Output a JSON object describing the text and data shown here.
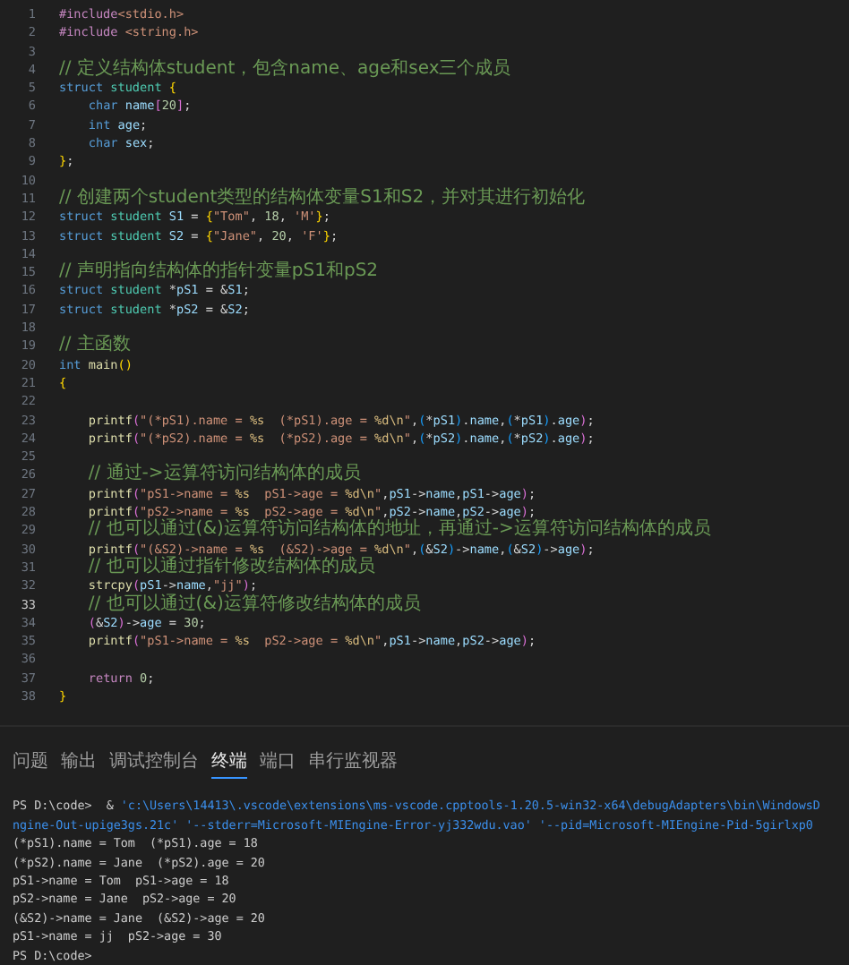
{
  "editor": {
    "lines": [
      {
        "number": "1",
        "active": false,
        "indented": false,
        "tokens": [
          {
            "kind": "pp",
            "text": "#include"
          },
          {
            "kind": "s",
            "text": "<stdio.h>"
          }
        ]
      },
      {
        "number": "2",
        "active": false,
        "indented": false,
        "tokens": [
          {
            "kind": "pp",
            "text": "#include "
          },
          {
            "kind": "s",
            "text": "<string.h>"
          }
        ]
      },
      {
        "number": "3",
        "active": false
      },
      {
        "number": "4",
        "active": false,
        "indented": false,
        "tokens": [
          {
            "kind": "c",
            "text": "// 定义结构体student，包含name、age和sex三个成员"
          }
        ]
      },
      {
        "number": "5",
        "active": false,
        "indented": false,
        "tokens": [
          {
            "kind": "kw",
            "text": "struct "
          },
          {
            "kind": "ty",
            "text": "student "
          },
          {
            "kind": "b1",
            "text": "{"
          }
        ]
      },
      {
        "number": "6",
        "active": false,
        "indented": true,
        "tokens": [
          {
            "kind": "kw",
            "text": "char "
          },
          {
            "kind": "v",
            "text": "name"
          },
          {
            "kind": "b2",
            "text": "["
          },
          {
            "kind": "n",
            "text": "20"
          },
          {
            "kind": "b2",
            "text": "]"
          },
          {
            "kind": "p",
            "text": ";"
          }
        ]
      },
      {
        "number": "7",
        "active": false,
        "indented": true,
        "tokens": [
          {
            "kind": "kw",
            "text": "int "
          },
          {
            "kind": "v",
            "text": "age"
          },
          {
            "kind": "p",
            "text": ";"
          }
        ]
      },
      {
        "number": "8",
        "active": false,
        "indented": true,
        "tokens": [
          {
            "kind": "kw",
            "text": "char "
          },
          {
            "kind": "v",
            "text": "sex"
          },
          {
            "kind": "p",
            "text": ";"
          }
        ]
      },
      {
        "number": "9",
        "active": false,
        "indented": false,
        "tokens": [
          {
            "kind": "b1",
            "text": "}"
          },
          {
            "kind": "p",
            "text": ";"
          }
        ]
      },
      {
        "number": "10",
        "active": false
      },
      {
        "number": "11",
        "active": false,
        "indented": false,
        "tokens": [
          {
            "kind": "c",
            "text": "// 创建两个student类型的结构体变量S1和S2，并对其进行初始化"
          }
        ]
      },
      {
        "number": "12",
        "active": false,
        "indented": false,
        "tokens": [
          {
            "kind": "kw",
            "text": "struct "
          },
          {
            "kind": "ty",
            "text": "student "
          },
          {
            "kind": "v",
            "text": "S1"
          },
          {
            "kind": "p",
            "text": " = "
          },
          {
            "kind": "b1",
            "text": "{"
          },
          {
            "kind": "s",
            "text": "\"Tom\""
          },
          {
            "kind": "p",
            "text": ", "
          },
          {
            "kind": "n",
            "text": "18"
          },
          {
            "kind": "p",
            "text": ", "
          },
          {
            "kind": "s",
            "text": "'M'"
          },
          {
            "kind": "b1",
            "text": "}"
          },
          {
            "kind": "p",
            "text": ";"
          }
        ]
      },
      {
        "number": "13",
        "active": false,
        "indented": false,
        "tokens": [
          {
            "kind": "kw",
            "text": "struct "
          },
          {
            "kind": "ty",
            "text": "student "
          },
          {
            "kind": "v",
            "text": "S2"
          },
          {
            "kind": "p",
            "text": " = "
          },
          {
            "kind": "b1",
            "text": "{"
          },
          {
            "kind": "s",
            "text": "\"Jane\""
          },
          {
            "kind": "p",
            "text": ", "
          },
          {
            "kind": "n",
            "text": "20"
          },
          {
            "kind": "p",
            "text": ", "
          },
          {
            "kind": "s",
            "text": "'F'"
          },
          {
            "kind": "b1",
            "text": "}"
          },
          {
            "kind": "p",
            "text": ";"
          }
        ]
      },
      {
        "number": "14",
        "active": false
      },
      {
        "number": "15",
        "active": false,
        "indented": false,
        "tokens": [
          {
            "kind": "c",
            "text": "// 声明指向结构体的指针变量pS1和pS2"
          }
        ]
      },
      {
        "number": "16",
        "active": false,
        "indented": false,
        "tokens": [
          {
            "kind": "kw",
            "text": "struct "
          },
          {
            "kind": "ty",
            "text": "student "
          },
          {
            "kind": "p",
            "text": "*"
          },
          {
            "kind": "v",
            "text": "pS1"
          },
          {
            "kind": "p",
            "text": " = &"
          },
          {
            "kind": "v",
            "text": "S1"
          },
          {
            "kind": "p",
            "text": ";"
          }
        ]
      },
      {
        "number": "17",
        "active": false,
        "indented": false,
        "tokens": [
          {
            "kind": "kw",
            "text": "struct "
          },
          {
            "kind": "ty",
            "text": "student "
          },
          {
            "kind": "p",
            "text": "*"
          },
          {
            "kind": "v",
            "text": "pS2"
          },
          {
            "kind": "p",
            "text": " = &"
          },
          {
            "kind": "v",
            "text": "S2"
          },
          {
            "kind": "p",
            "text": ";"
          }
        ]
      },
      {
        "number": "18",
        "active": false
      },
      {
        "number": "19",
        "active": false,
        "indented": false,
        "tokens": [
          {
            "kind": "c",
            "text": "// 主函数"
          }
        ]
      },
      {
        "number": "20",
        "active": false,
        "indented": false,
        "tokens": [
          {
            "kind": "kw",
            "text": "int "
          },
          {
            "kind": "fn",
            "text": "main"
          },
          {
            "kind": "b1",
            "text": "()"
          }
        ]
      },
      {
        "number": "21",
        "active": false,
        "indented": false,
        "tokens": [
          {
            "kind": "b1",
            "text": "{"
          }
        ]
      },
      {
        "number": "22",
        "active": false
      },
      {
        "number": "23",
        "active": false,
        "indented": true,
        "tokens": [
          {
            "kind": "fn",
            "text": "printf"
          },
          {
            "kind": "b2",
            "text": "("
          },
          {
            "kind": "s",
            "text": "\"(*pS1).name = "
          },
          {
            "kind": "esc",
            "text": "%s"
          },
          {
            "kind": "s",
            "text": "  (*pS1).age = "
          },
          {
            "kind": "esc",
            "text": "%d\\n"
          },
          {
            "kind": "s",
            "text": "\""
          },
          {
            "kind": "p",
            "text": ","
          },
          {
            "kind": "b3",
            "text": "("
          },
          {
            "kind": "p",
            "text": "*"
          },
          {
            "kind": "v",
            "text": "pS1"
          },
          {
            "kind": "b3",
            "text": ")"
          },
          {
            "kind": "p",
            "text": "."
          },
          {
            "kind": "v",
            "text": "name"
          },
          {
            "kind": "p",
            "text": ","
          },
          {
            "kind": "b3",
            "text": "("
          },
          {
            "kind": "p",
            "text": "*"
          },
          {
            "kind": "v",
            "text": "pS1"
          },
          {
            "kind": "b3",
            "text": ")"
          },
          {
            "kind": "p",
            "text": "."
          },
          {
            "kind": "v",
            "text": "age"
          },
          {
            "kind": "b2",
            "text": ")"
          },
          {
            "kind": "p",
            "text": ";"
          }
        ]
      },
      {
        "number": "24",
        "active": false,
        "indented": true,
        "tokens": [
          {
            "kind": "fn",
            "text": "printf"
          },
          {
            "kind": "b2",
            "text": "("
          },
          {
            "kind": "s",
            "text": "\"(*pS2).name = "
          },
          {
            "kind": "esc",
            "text": "%s"
          },
          {
            "kind": "s",
            "text": "  (*pS2).age = "
          },
          {
            "kind": "esc",
            "text": "%d\\n"
          },
          {
            "kind": "s",
            "text": "\""
          },
          {
            "kind": "p",
            "text": ","
          },
          {
            "kind": "b3",
            "text": "("
          },
          {
            "kind": "p",
            "text": "*"
          },
          {
            "kind": "v",
            "text": "pS2"
          },
          {
            "kind": "b3",
            "text": ")"
          },
          {
            "kind": "p",
            "text": "."
          },
          {
            "kind": "v",
            "text": "name"
          },
          {
            "kind": "p",
            "text": ","
          },
          {
            "kind": "b3",
            "text": "("
          },
          {
            "kind": "p",
            "text": "*"
          },
          {
            "kind": "v",
            "text": "pS2"
          },
          {
            "kind": "b3",
            "text": ")"
          },
          {
            "kind": "p",
            "text": "."
          },
          {
            "kind": "v",
            "text": "age"
          },
          {
            "kind": "b2",
            "text": ")"
          },
          {
            "kind": "p",
            "text": ";"
          }
        ]
      },
      {
        "number": "25",
        "active": false
      },
      {
        "number": "26",
        "active": false,
        "indented": true,
        "tokens": [
          {
            "kind": "c",
            "text": "// 通过->运算符访问结构体的成员"
          }
        ]
      },
      {
        "number": "27",
        "active": false,
        "indented": true,
        "tokens": [
          {
            "kind": "fn",
            "text": "printf"
          },
          {
            "kind": "b2",
            "text": "("
          },
          {
            "kind": "s",
            "text": "\"pS1->name = "
          },
          {
            "kind": "esc",
            "text": "%s"
          },
          {
            "kind": "s",
            "text": "  pS1->age = "
          },
          {
            "kind": "esc",
            "text": "%d\\n"
          },
          {
            "kind": "s",
            "text": "\""
          },
          {
            "kind": "p",
            "text": ","
          },
          {
            "kind": "v",
            "text": "pS1"
          },
          {
            "kind": "p",
            "text": "->"
          },
          {
            "kind": "v",
            "text": "name"
          },
          {
            "kind": "p",
            "text": ","
          },
          {
            "kind": "v",
            "text": "pS1"
          },
          {
            "kind": "p",
            "text": "->"
          },
          {
            "kind": "v",
            "text": "age"
          },
          {
            "kind": "b2",
            "text": ")"
          },
          {
            "kind": "p",
            "text": ";"
          }
        ]
      },
      {
        "number": "28",
        "active": false,
        "indented": true,
        "tokens": [
          {
            "kind": "fn",
            "text": "printf"
          },
          {
            "kind": "b2",
            "text": "("
          },
          {
            "kind": "s",
            "text": "\"pS2->name = "
          },
          {
            "kind": "esc",
            "text": "%s"
          },
          {
            "kind": "s",
            "text": "  pS2->age = "
          },
          {
            "kind": "esc",
            "text": "%d\\n"
          },
          {
            "kind": "s",
            "text": "\""
          },
          {
            "kind": "p",
            "text": ","
          },
          {
            "kind": "v",
            "text": "pS2"
          },
          {
            "kind": "p",
            "text": "->"
          },
          {
            "kind": "v",
            "text": "name"
          },
          {
            "kind": "p",
            "text": ","
          },
          {
            "kind": "v",
            "text": "pS2"
          },
          {
            "kind": "p",
            "text": "->"
          },
          {
            "kind": "v",
            "text": "age"
          },
          {
            "kind": "b2",
            "text": ")"
          },
          {
            "kind": "p",
            "text": ";"
          }
        ]
      },
      {
        "number": "29",
        "active": false,
        "indented": true,
        "tokens": [
          {
            "kind": "c",
            "text": "// 也可以通过(&)运算符访问结构体的地址，再通过->运算符访问结构体的成员"
          }
        ]
      },
      {
        "number": "30",
        "active": false,
        "indented": true,
        "tokens": [
          {
            "kind": "fn",
            "text": "printf"
          },
          {
            "kind": "b2",
            "text": "("
          },
          {
            "kind": "s",
            "text": "\"(&S2)->name = "
          },
          {
            "kind": "esc",
            "text": "%s"
          },
          {
            "kind": "s",
            "text": "  (&S2)->age = "
          },
          {
            "kind": "esc",
            "text": "%d\\n"
          },
          {
            "kind": "s",
            "text": "\""
          },
          {
            "kind": "p",
            "text": ","
          },
          {
            "kind": "b3",
            "text": "("
          },
          {
            "kind": "p",
            "text": "&"
          },
          {
            "kind": "v",
            "text": "S2"
          },
          {
            "kind": "b3",
            "text": ")"
          },
          {
            "kind": "p",
            "text": "->"
          },
          {
            "kind": "v",
            "text": "name"
          },
          {
            "kind": "p",
            "text": ","
          },
          {
            "kind": "b3",
            "text": "("
          },
          {
            "kind": "p",
            "text": "&"
          },
          {
            "kind": "v",
            "text": "S2"
          },
          {
            "kind": "b3",
            "text": ")"
          },
          {
            "kind": "p",
            "text": "->"
          },
          {
            "kind": "v",
            "text": "age"
          },
          {
            "kind": "b2",
            "text": ")"
          },
          {
            "kind": "p",
            "text": ";"
          }
        ]
      },
      {
        "number": "31",
        "active": false,
        "indented": true,
        "tokens": [
          {
            "kind": "c",
            "text": "// 也可以通过指针修改结构体的成员"
          }
        ]
      },
      {
        "number": "32",
        "active": false,
        "indented": true,
        "tokens": [
          {
            "kind": "fn",
            "text": "strcpy"
          },
          {
            "kind": "b2",
            "text": "("
          },
          {
            "kind": "v",
            "text": "pS1"
          },
          {
            "kind": "p",
            "text": "->"
          },
          {
            "kind": "v",
            "text": "name"
          },
          {
            "kind": "p",
            "text": ","
          },
          {
            "kind": "s",
            "text": "\"jj\""
          },
          {
            "kind": "b2",
            "text": ")"
          },
          {
            "kind": "p",
            "text": ";"
          }
        ]
      },
      {
        "number": "33",
        "active": true,
        "indented": true,
        "tokens": [
          {
            "kind": "c",
            "text": "// 也可以通过(&)运算符修改结构体的成员"
          }
        ]
      },
      {
        "number": "34",
        "active": false,
        "indented": true,
        "tokens": [
          {
            "kind": "b2",
            "text": "("
          },
          {
            "kind": "p",
            "text": "&"
          },
          {
            "kind": "v",
            "text": "S2"
          },
          {
            "kind": "b2",
            "text": ")"
          },
          {
            "kind": "p",
            "text": "->"
          },
          {
            "kind": "v",
            "text": "age"
          },
          {
            "kind": "p",
            "text": " = "
          },
          {
            "kind": "n",
            "text": "30"
          },
          {
            "kind": "p",
            "text": ";"
          }
        ]
      },
      {
        "number": "35",
        "active": false,
        "indented": true,
        "tokens": [
          {
            "kind": "fn",
            "text": "printf"
          },
          {
            "kind": "b2",
            "text": "("
          },
          {
            "kind": "s",
            "text": "\"pS1->name = "
          },
          {
            "kind": "esc",
            "text": "%s"
          },
          {
            "kind": "s",
            "text": "  pS2->age = "
          },
          {
            "kind": "esc",
            "text": "%d\\n"
          },
          {
            "kind": "s",
            "text": "\""
          },
          {
            "kind": "p",
            "text": ","
          },
          {
            "kind": "v",
            "text": "pS1"
          },
          {
            "kind": "p",
            "text": "->"
          },
          {
            "kind": "v",
            "text": "name"
          },
          {
            "kind": "p",
            "text": ","
          },
          {
            "kind": "v",
            "text": "pS2"
          },
          {
            "kind": "p",
            "text": "->"
          },
          {
            "kind": "v",
            "text": "age"
          },
          {
            "kind": "b2",
            "text": ")"
          },
          {
            "kind": "p",
            "text": ";"
          }
        ]
      },
      {
        "number": "36",
        "active": false
      },
      {
        "number": "37",
        "active": false,
        "indented": true,
        "tokens": [
          {
            "kind": "ctl",
            "text": "return "
          },
          {
            "kind": "n",
            "text": "0"
          },
          {
            "kind": "p",
            "text": ";"
          }
        ]
      },
      {
        "number": "38",
        "active": false,
        "indented": false,
        "tokens": [
          {
            "kind": "b1",
            "text": "}"
          }
        ]
      }
    ]
  },
  "panel": {
    "tabs": [
      {
        "label": "问题",
        "selected": false
      },
      {
        "label": "输出",
        "selected": false
      },
      {
        "label": "调试控制台",
        "selected": false
      },
      {
        "label": "终端",
        "selected": true
      },
      {
        "label": "端口",
        "selected": false
      },
      {
        "label": "串行监视器",
        "selected": false
      }
    ],
    "terminal": [
      [
        {
          "kind": "p",
          "text": "PS D:\\code>  & "
        },
        {
          "kind": "s",
          "text": "'c:\\Users\\14413\\.vscode\\extensions\\ms-vscode.cpptools-1.20.5-win32-x64\\debugAdapters\\bin\\WindowsD"
        }
      ],
      [
        {
          "kind": "s",
          "text": "ngine-Out-upige3gs.21c' '--stderr=Microsoft-MIEngine-Error-yj332wdu.vao' '--pid=Microsoft-MIEngine-Pid-5girlxp0"
        }
      ],
      [
        {
          "kind": "p",
          "text": "(*pS1).name = Tom  (*pS1).age = 18"
        }
      ],
      [
        {
          "kind": "p",
          "text": "(*pS2).name = Jane  (*pS2).age = 20"
        }
      ],
      [
        {
          "kind": "p",
          "text": "pS1->name = Tom  pS1->age = 18"
        }
      ],
      [
        {
          "kind": "p",
          "text": "pS2->name = Jane  pS2->age = 20"
        }
      ],
      [
        {
          "kind": "p",
          "text": "(&S2)->name = Jane  (&S2)->age = 20"
        }
      ],
      [
        {
          "kind": "p",
          "text": "pS1->name = jj  pS2->age = 30"
        }
      ],
      [
        {
          "kind": "p",
          "text": "PS D:\\code>"
        }
      ]
    ]
  }
}
